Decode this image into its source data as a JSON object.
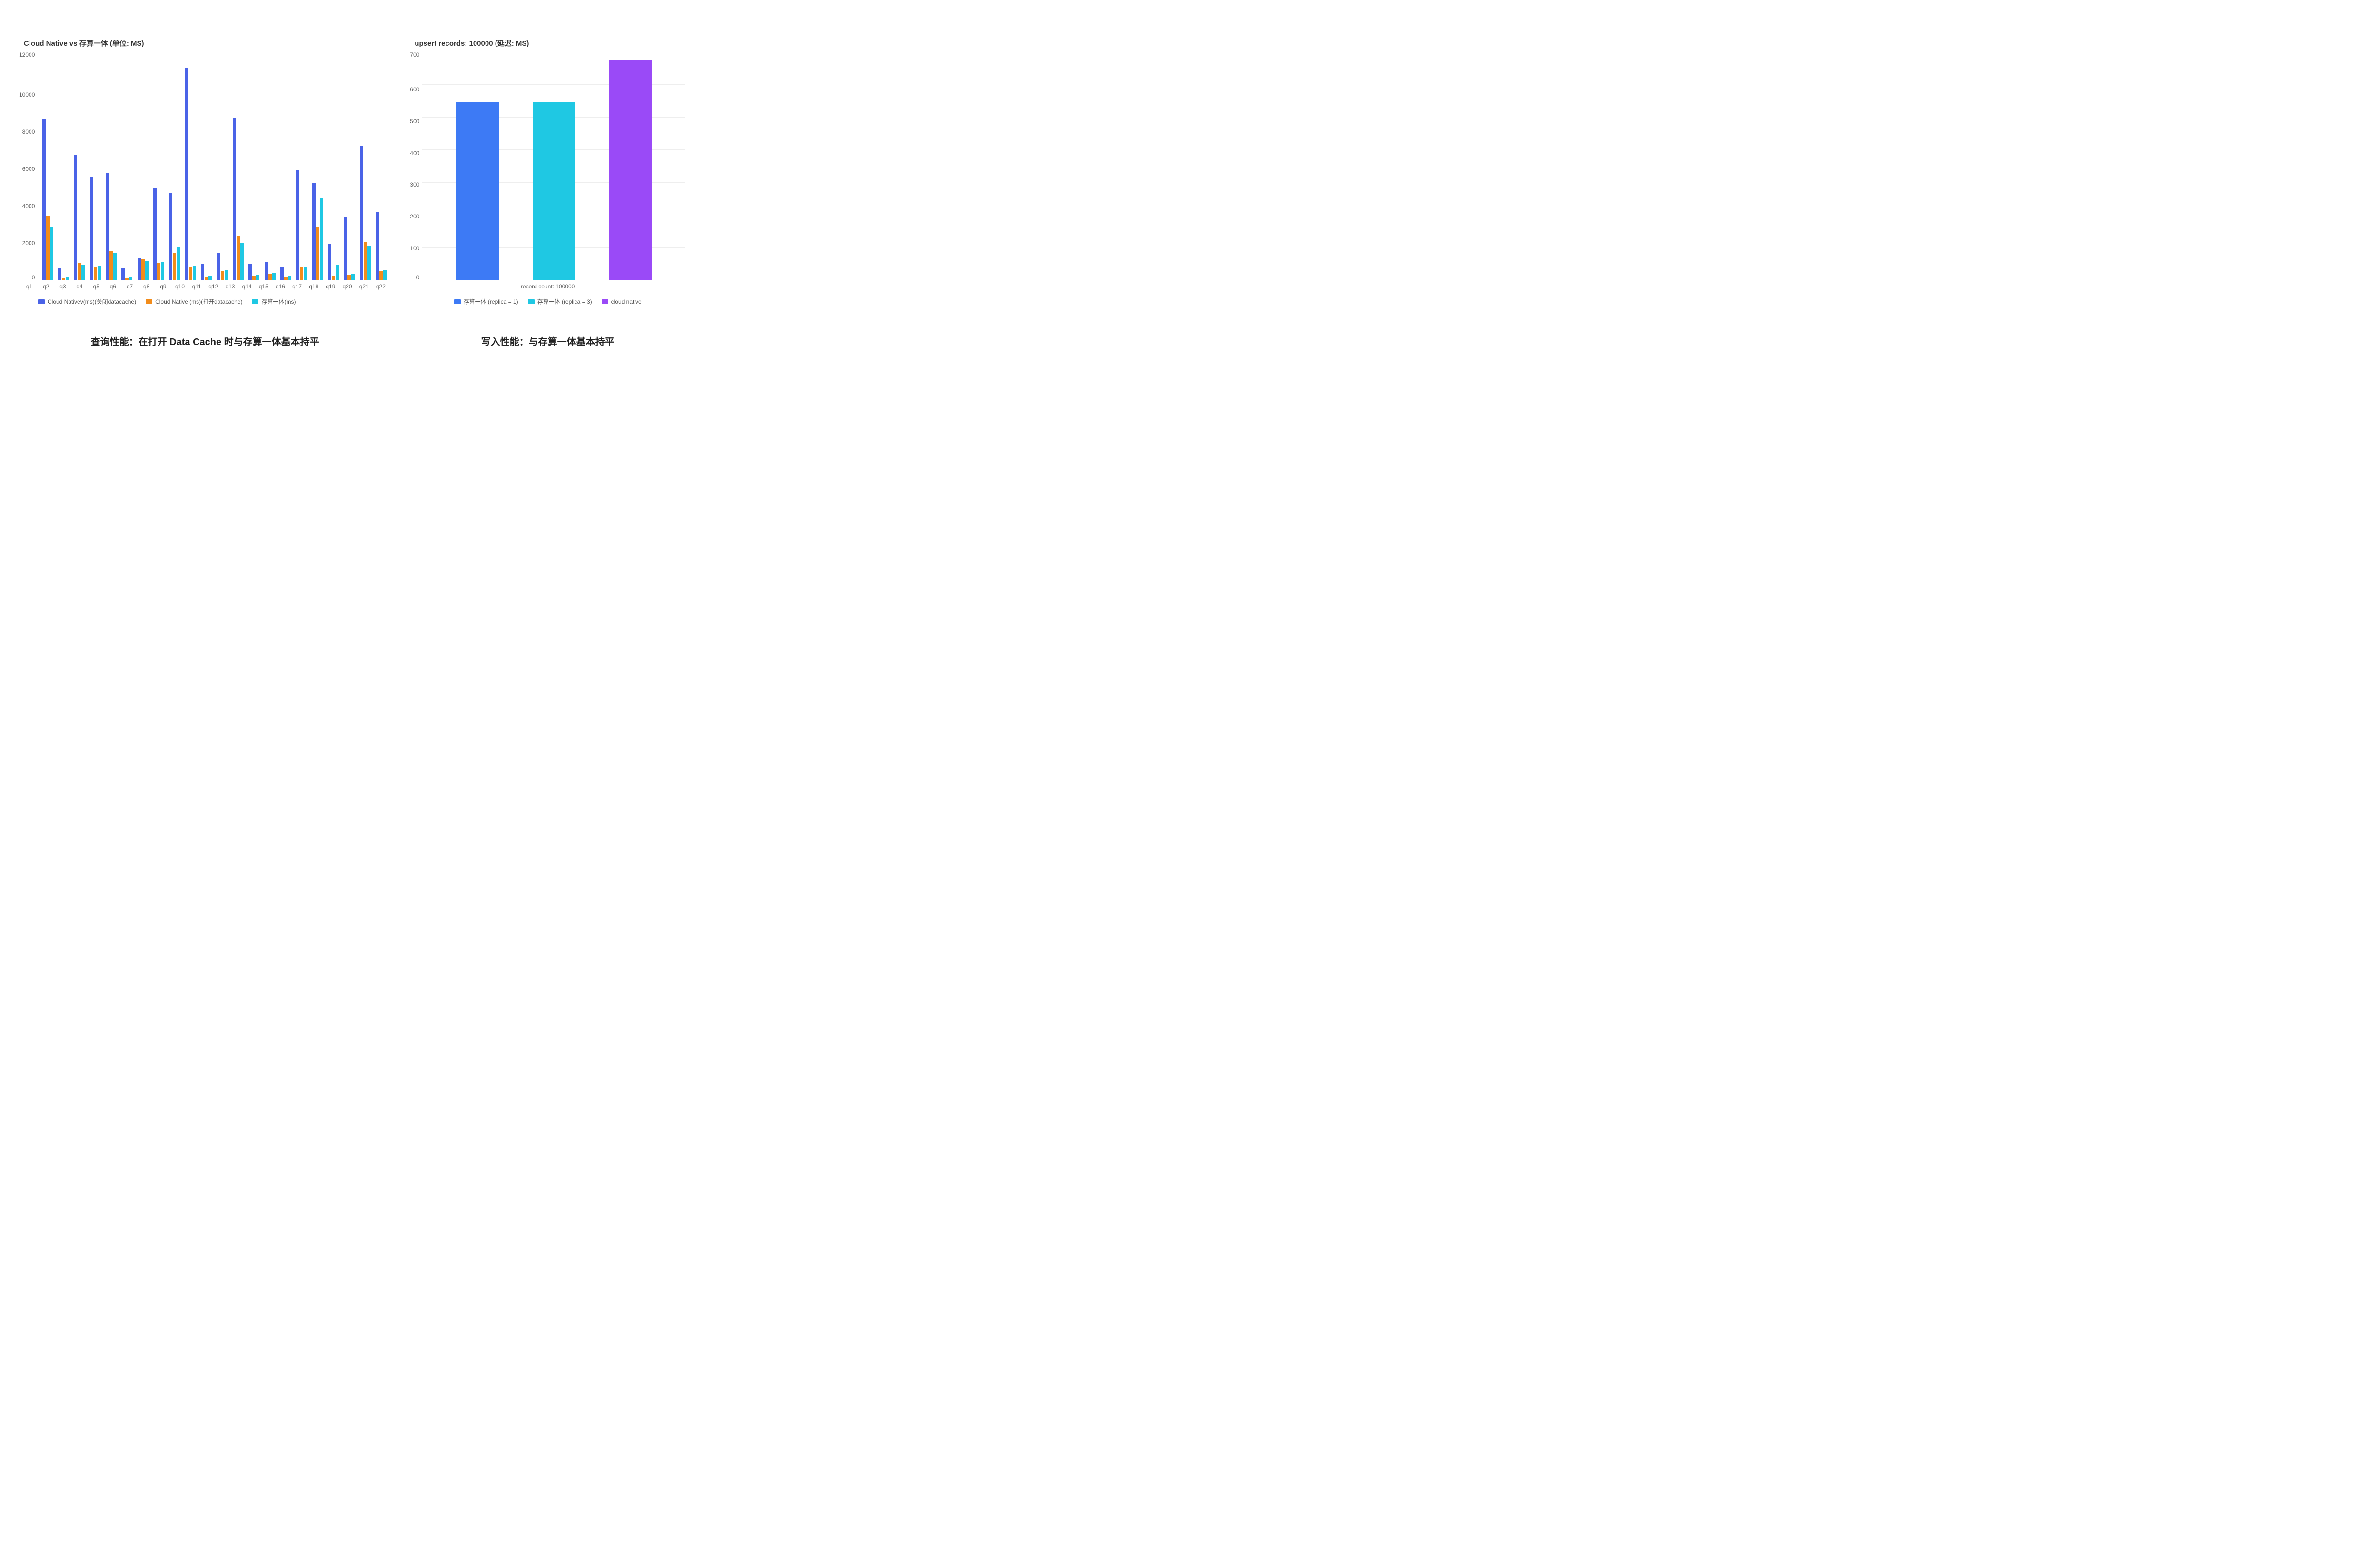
{
  "chart_data": [
    {
      "id": "left",
      "type": "bar",
      "title": "Cloud Native vs 存算一体 (单位: MS)",
      "ylabel": "",
      "xlabel": "",
      "ylim": [
        0,
        12000
      ],
      "yticks": [
        0,
        2000,
        4000,
        6000,
        8000,
        10000,
        12000
      ],
      "categories": [
        "q1",
        "q2",
        "q3",
        "q4",
        "q5",
        "q6",
        "q7",
        "q8",
        "q9",
        "q10",
        "q11",
        "q12",
        "q13",
        "q14",
        "q15",
        "q16",
        "q17",
        "q18",
        "q19",
        "q20",
        "q21",
        "q22"
      ],
      "series": [
        {
          "name": "Cloud Nativev(ms)(关闭datacache)",
          "color": "#4a63e7",
          "values": [
            8500,
            600,
            6600,
            5400,
            5600,
            600,
            1150,
            4850,
            4550,
            11150,
            850,
            1400,
            8550,
            850,
            950,
            700,
            5750,
            5100,
            1900,
            3300,
            7050,
            3550
          ]
        },
        {
          "name": "Cloud Native (ms)(打开datacache)",
          "color": "#f28c1b",
          "values": [
            3350,
            100,
            900,
            700,
            1500,
            100,
            1100,
            900,
            1400,
            700,
            150,
            450,
            2300,
            200,
            300,
            150,
            650,
            2750,
            200,
            250,
            2000,
            450
          ]
        },
        {
          "name": "存算一体(ms)",
          "color": "#1fc8e3",
          "values": [
            2750,
            150,
            800,
            750,
            1400,
            150,
            1000,
            950,
            1750,
            750,
            200,
            500,
            1950,
            250,
            350,
            200,
            700,
            4300,
            800,
            300,
            1800,
            500
          ]
        }
      ],
      "caption": "查询性能：在打开 Data Cache 时与存算一体基本持平"
    },
    {
      "id": "right",
      "type": "bar",
      "title": "upsert records: 100000 (延迟: MS)",
      "ylabel": "",
      "xlabel": "record count: 100000",
      "ylim": [
        0,
        700
      ],
      "yticks": [
        0,
        100,
        200,
        300,
        400,
        500,
        600,
        700
      ],
      "categories": [
        "record count: 100000"
      ],
      "series": [
        {
          "name": "存算一体 (replica = 1)",
          "color": "#3d7af5",
          "values": [
            545
          ]
        },
        {
          "name": "存算一体 (replica = 3)",
          "color": "#1fc8e3",
          "values": [
            545
          ]
        },
        {
          "name": "cloud native",
          "color": "#9a4af7",
          "values": [
            675
          ]
        }
      ],
      "caption": "写入性能：与存算一体基本持平"
    }
  ]
}
